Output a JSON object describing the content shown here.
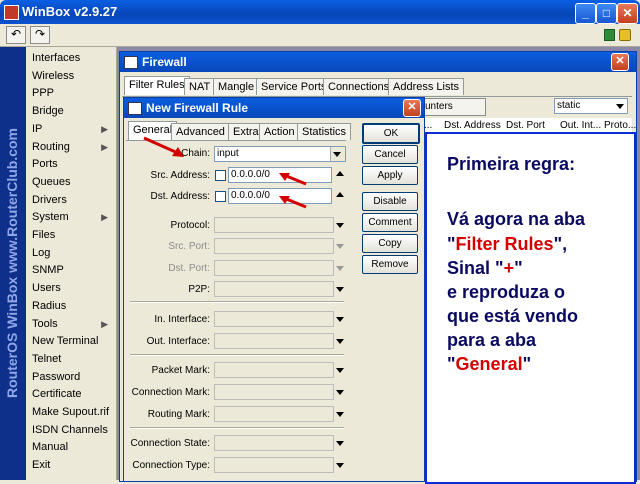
{
  "window": {
    "title": "WinBox v2.9.27"
  },
  "brand": "RouterOS WinBox   www.RouterClub.com",
  "menu": [
    "Interfaces",
    "Wireless",
    "PPP",
    "Bridge",
    "IP",
    "Routing",
    "Ports",
    "Queues",
    "Drivers",
    "System",
    "Files",
    "Log",
    "SNMP",
    "Users",
    "Radius",
    "Tools",
    "New Terminal",
    "Telnet",
    "Password",
    "Certificate",
    "Make Supout.rif",
    "ISDN Channels",
    "Manual",
    "Exit"
  ],
  "firewall": {
    "title": "Firewall",
    "tabs": [
      "Filter Rules",
      "NAT",
      "Mangle",
      "Service Ports",
      "Connections",
      "Address Lists"
    ],
    "counters_label": "unters",
    "static_value": "static",
    "columns": [
      "...",
      "Dst. Address",
      "Dst. Port",
      "Out. Int...",
      "Proto..."
    ]
  },
  "dialog": {
    "title": "New Firewall Rule",
    "tabs": [
      "General",
      "Advanced",
      "Extra",
      "Action",
      "Statistics"
    ],
    "labels": {
      "chain": "Chain:",
      "src": "Src. Address:",
      "dst": "Dst. Address:",
      "protocol": "Protocol:",
      "srcport": "Src. Port:",
      "dstport": "Dst. Port:",
      "p2p": "P2P:",
      "inif": "In. Interface:",
      "outif": "Out. Interface:",
      "packetmark": "Packet Mark:",
      "connmark": "Connection Mark:",
      "routingmark": "Routing Mark:",
      "connstate": "Connection State:",
      "conntype": "Connection Type:"
    },
    "values": {
      "chain": "input",
      "src": "0.0.0.0/0",
      "dst": "0.0.0.0/0"
    },
    "buttons": [
      "OK",
      "Cancel",
      "Apply",
      "Disable",
      "Comment",
      "Copy",
      "Remove"
    ]
  },
  "note": {
    "line1": "Primeira regra:",
    "line2": "Vá agora na aba",
    "line3a": "\"",
    "line3b": "Filter Rules",
    "line3c": "\",",
    "line4a": "Sinal \"",
    "line4b": "+",
    "line4c": "\"",
    "line5": "e reproduza o",
    "line6": "que está vendo",
    "line7": "para a aba",
    "line8a": "\"",
    "line8b": "General",
    "line8c": "\""
  },
  "colors": {
    "arrow": "#d40000",
    "note_border": "#0b2bd6"
  }
}
